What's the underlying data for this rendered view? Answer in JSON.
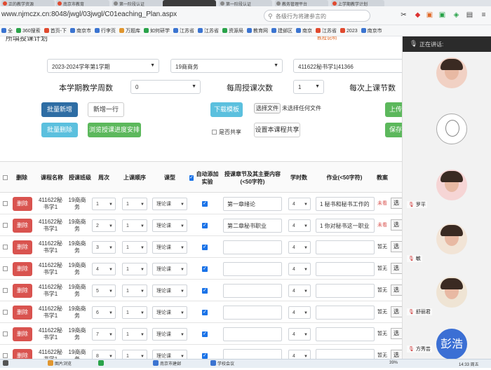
{
  "browser": {
    "tabs": [
      {
        "label": "正的教学资源",
        "color": "#e04a2f"
      },
      {
        "label": "南京市教育",
        "color": "#e04a2f"
      },
      {
        "label": "第一阶段认证",
        "color": "#888888"
      },
      {
        "label": "",
        "color": "#3c3c3c"
      },
      {
        "label": "第一阶段认证",
        "color": "#888888"
      },
      {
        "label": "教务管理平台",
        "color": "#888888"
      },
      {
        "label": "上学期教学计划",
        "color": "#e04a2f"
      }
    ],
    "url": "www.njmczx.cn:8048/jwgl/03jwgl/C01eaching_Plan.aspx",
    "search_placeholder": "各级行为将建参言的",
    "bookmarks": [
      {
        "label": "全",
        "color": "#3b74d1"
      },
      {
        "label": "360搜索",
        "color": "#2aa34a"
      },
      {
        "label": "首页-下",
        "color": "#e04a2f"
      },
      {
        "label": "南京市",
        "color": "#3b74d1"
      },
      {
        "label": "行李页",
        "color": "#3b74d1"
      },
      {
        "label": "万题库",
        "color": "#e0962f"
      },
      {
        "label": "如何研学",
        "color": "#2aa34a"
      },
      {
        "label": "江苏省",
        "color": "#3b74d1"
      },
      {
        "label": "江苏省",
        "color": "#3b74d1"
      },
      {
        "label": "资源局",
        "color": "#2aa34a"
      },
      {
        "label": "教育网",
        "color": "#3b74d1"
      },
      {
        "label": "建邺区",
        "color": "#3b74d1"
      },
      {
        "label": "南京",
        "color": "#3b74d1"
      },
      {
        "label": "江苏省",
        "color": "#e04a2f"
      },
      {
        "label": "2023",
        "color": "#e04a2f"
      },
      {
        "label": "南京市",
        "color": "#3b74d1"
      }
    ]
  },
  "page": {
    "title_fragment": "所填投课计划",
    "link_fragment": "教程说明",
    "selects": {
      "semester": "2023-2024学年第1学期",
      "class": "19商商务",
      "course": "411622秘书学1|41366",
      "weeks": "0",
      "hours": "1"
    },
    "labels": {
      "weeks": "本学期教学周数",
      "hours": "每周授课次数",
      "sessions": "每次上课节数"
    },
    "buttons": {
      "batch_add": "批量新增",
      "add_row": "新增一行",
      "download_template": "下载模板",
      "choose_file": "选择文件",
      "file_status": "未选择任何文件",
      "upload": "上传",
      "batch_delete": "批量删除",
      "browse_progress": "浏览授课进度安排",
      "is_shared": "是否共享",
      "set_shared": "设置本课程共享",
      "save": "保存"
    }
  },
  "table": {
    "headers": [
      "删除",
      "课程名称",
      "授课班级",
      "周次",
      "上课顺序",
      "课型",
      "自动添加实验",
      "授课章节及其主要内容(<50字符)",
      "学时数",
      "作业(<50字符)",
      "教案"
    ],
    "delete_label": "删除",
    "pick_label": "选",
    "rows": [
      {
        "course": "411622秘书学1",
        "class": "19商商务",
        "week": "1",
        "order": "1",
        "type": "理论课",
        "auto": true,
        "content": "第一章绪论",
        "hours": "4",
        "homework": "1 秘书和秘书工作的",
        "plan": "未看"
      },
      {
        "course": "411622秘书学1",
        "class": "19商商务",
        "week": "2",
        "order": "1",
        "type": "理论课",
        "auto": true,
        "content": "第二章秘书职业",
        "hours": "4",
        "homework": "1 你对秘书这一职业",
        "plan": "未看"
      },
      {
        "course": "411622秘书学1",
        "class": "19商商务",
        "week": "3",
        "order": "1",
        "type": "理论课",
        "auto": true,
        "content": "",
        "hours": "4",
        "homework": "",
        "plan": "暂无"
      },
      {
        "course": "411622秘书学1",
        "class": "19商商务",
        "week": "4",
        "order": "1",
        "type": "理论课",
        "auto": true,
        "content": "",
        "hours": "4",
        "homework": "",
        "plan": "暂无"
      },
      {
        "course": "411622秘书学1",
        "class": "19商商务",
        "week": "5",
        "order": "1",
        "type": "理论课",
        "auto": true,
        "content": "",
        "hours": "4",
        "homework": "",
        "plan": "暂无"
      },
      {
        "course": "411622秘书学1",
        "class": "19商商务",
        "week": "6",
        "order": "1",
        "type": "理论课",
        "auto": true,
        "content": "",
        "hours": "4",
        "homework": "",
        "plan": "暂无"
      },
      {
        "course": "411622秘书学1",
        "class": "19商商务",
        "week": "7",
        "order": "1",
        "type": "理论课",
        "auto": true,
        "content": "",
        "hours": "4",
        "homework": "",
        "plan": "暂无"
      },
      {
        "course": "411622秘书学1",
        "class": "19商商务",
        "week": "8",
        "order": "1",
        "type": "理论课",
        "auto": true,
        "content": "",
        "hours": "4",
        "homework": "",
        "plan": "暂无"
      }
    ]
  },
  "meeting": {
    "speaking_label": "正在讲话:",
    "attendees": [
      {
        "name": "",
        "avatar": "photo"
      },
      {
        "name": "",
        "avatar": "drawing"
      },
      {
        "name": "罗平",
        "avatar": "photo"
      },
      {
        "name": "敏",
        "avatar": "photo"
      },
      {
        "name": "舒丽君",
        "avatar": "photo"
      },
      {
        "name": "彭浩",
        "avatar": "text",
        "avatar_text": "彭浩"
      }
    ],
    "current_speaker": "方秀芸"
  },
  "taskbar": {
    "items": [
      "",
      "图片浏览",
      "",
      "南京市建邺",
      "学校会议"
    ],
    "battery": "39%",
    "clock": "14:33 周五"
  },
  "colors": {
    "primary": "#2e6da4",
    "cyan": "#5bc0de",
    "green": "#5cb85c",
    "danger": "#d9534f",
    "checkbox": "#1a73e8"
  }
}
